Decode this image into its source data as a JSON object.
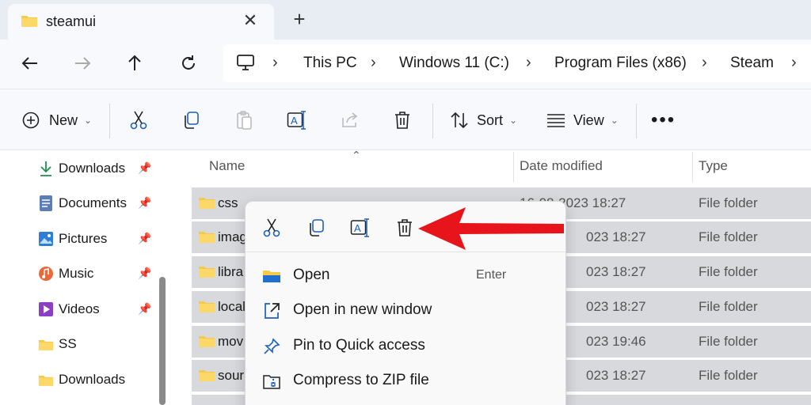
{
  "tab": {
    "title": "steamui",
    "close_icon": "close-icon",
    "new_tab_icon": "plus-icon"
  },
  "nav": {
    "breadcrumbs": [
      "This PC",
      "Windows 11 (C:)",
      "Program Files (x86)",
      "Steam"
    ]
  },
  "command_bar": {
    "new_label": "New",
    "sort_label": "Sort",
    "view_label": "View"
  },
  "sidebar": {
    "items": [
      {
        "label": "Downloads",
        "icon": "download-icon",
        "pinned": true
      },
      {
        "label": "Documents",
        "icon": "document-icon",
        "pinned": true
      },
      {
        "label": "Pictures",
        "icon": "pictures-icon",
        "pinned": true
      },
      {
        "label": "Music",
        "icon": "music-icon",
        "pinned": true
      },
      {
        "label": "Videos",
        "icon": "videos-icon",
        "pinned": true
      },
      {
        "label": "SS",
        "icon": "folder-icon",
        "pinned": false
      },
      {
        "label": "Downloads",
        "icon": "folder-icon",
        "pinned": false
      }
    ]
  },
  "columns": {
    "name": "Name",
    "date": "Date modified",
    "type": "Type"
  },
  "files": [
    {
      "name": "css",
      "date": "16-08-2023 18:27",
      "type": "File folder"
    },
    {
      "name": "imag",
      "date": "023 18:27",
      "type": "File folder"
    },
    {
      "name": "libra",
      "date": "023 18:27",
      "type": "File folder"
    },
    {
      "name": "local",
      "date": "023 18:27",
      "type": "File folder"
    },
    {
      "name": "mov",
      "date": "023 19:46",
      "type": "File folder"
    },
    {
      "name": "sour",
      "date": "023 18:27",
      "type": "File folder"
    }
  ],
  "context_menu": {
    "items": [
      {
        "label": "Open",
        "shortcut": "Enter",
        "icon": "folder-open-icon"
      },
      {
        "label": "Open in new window",
        "shortcut": "",
        "icon": "open-external-icon"
      },
      {
        "label": "Pin to Quick access",
        "shortcut": "",
        "icon": "pin-icon"
      },
      {
        "label": "Compress to ZIP file",
        "shortcut": "",
        "icon": "zip-icon"
      }
    ]
  },
  "colors": {
    "accent_arrow": "#e8141b",
    "folder": "#f7c948",
    "selection": "#d7d9dd"
  }
}
